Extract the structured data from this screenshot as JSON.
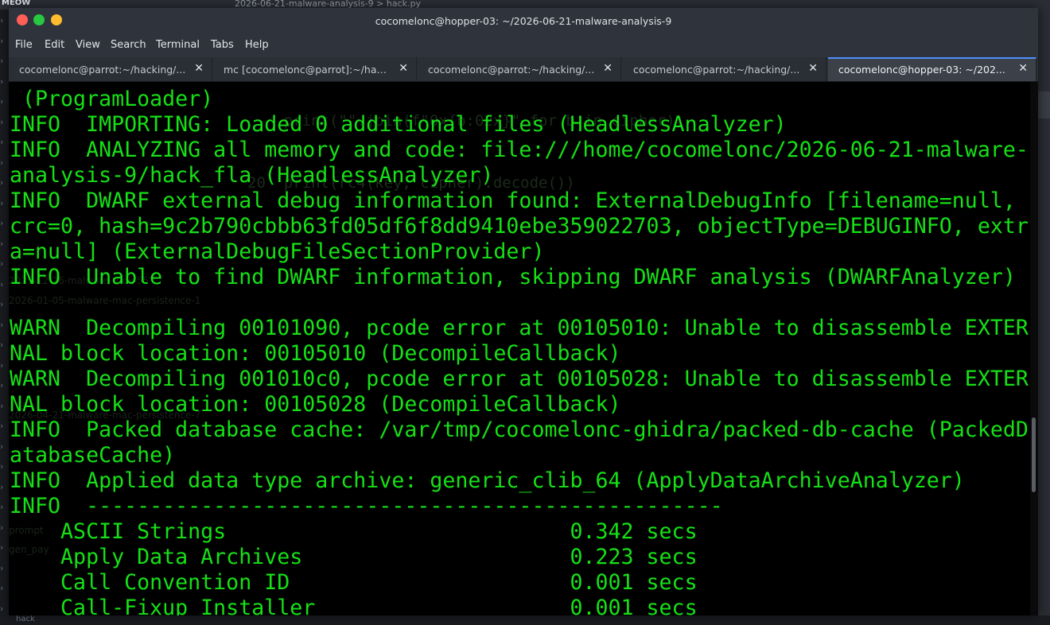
{
  "background": {
    "brand": "MEOW",
    "breadcrumb": "2026-06-21-malware-analysis-9 > hack.py",
    "bottom_file": "hack",
    "ghost_code": [
      "    print(\"\".join(f\"0x{b:02x}\" for b in cipher))",
      "20  print(rc4(key, cipher).decode())"
    ],
    "ghost_files": [
      "2025-12-26-malware-trick-55",
      "2026-01-05-malware-mac-persistence-1",
      "2026-04-21-malware-mac-persistence-7",
      "prompt",
      "gen_pay"
    ]
  },
  "window": {
    "title": "cocomelonc@hopper-03: ~/2026-06-21-malware-analysis-9"
  },
  "menu": [
    "File",
    "Edit",
    "View",
    "Search",
    "Terminal",
    "Tabs",
    "Help"
  ],
  "tabs": [
    {
      "label": "cocomelonc@parrot:~/hacking/...",
      "close": "✕"
    },
    {
      "label": "mc [cocomelonc@parrot]:~/hac...",
      "close": "✕"
    },
    {
      "label": "cocomelonc@parrot:~/hacking/...",
      "close": "✕"
    },
    {
      "label": "cocomelonc@parrot:~/hacking/...",
      "close": "✕"
    },
    {
      "label": "cocomelonc@hopper-03: ~/202...",
      "close": "✕"
    }
  ],
  "terminal": {
    "lines": [
      " (ProgramLoader)",
      "INFO  IMPORTING: Loaded 0 additional files (HeadlessAnalyzer)",
      "INFO  ANALYZING all memory and code: file:///home/cocomelonc/2026-06-21-malware-",
      "analysis-9/hack_fla (HeadlessAnalyzer)",
      "INFO  DWARF external debug information found: ExternalDebugInfo [filename=null,",
      "crc=0, hash=9c2b790cbbb63fd05df6f8dd9410ebe359022703, objectType=DEBUGINFO, extr",
      "a=null] (ExternalDebugFileSectionProvider)",
      "INFO  Unable to find DWARF information, skipping DWARF analysis (DWARFAnalyzer)",
      "",
      "WARN  Decompiling 00101090, pcode error at 00105010: Unable to disassemble EXTER",
      "NAL block location: 00105010 (DecompileCallback)",
      "WARN  Decompiling 001010c0, pcode error at 00105028: Unable to disassemble EXTER",
      "NAL block location: 00105028 (DecompileCallback)",
      "INFO  Packed database cache: /var/tmp/cocomelonc-ghidra/packed-db-cache (PackedD",
      "atabaseCache)",
      "INFO  Applied data type archive: generic_clib_64 (ApplyDataArchiveAnalyzer)",
      "INFO  --------------------------------------------------",
      "    ASCII Strings                           0.342 secs",
      "    Apply Data Archives                     0.223 secs",
      "    Call Convention ID                      0.001 secs",
      "    Call-Fixup Installer                    0.001 secs"
    ]
  },
  "colors": {
    "terminal_text": "#16e016",
    "terminal_bg": "#000000",
    "titlebar": "#2f343c",
    "active_tab_accent": "#4d90fe"
  }
}
